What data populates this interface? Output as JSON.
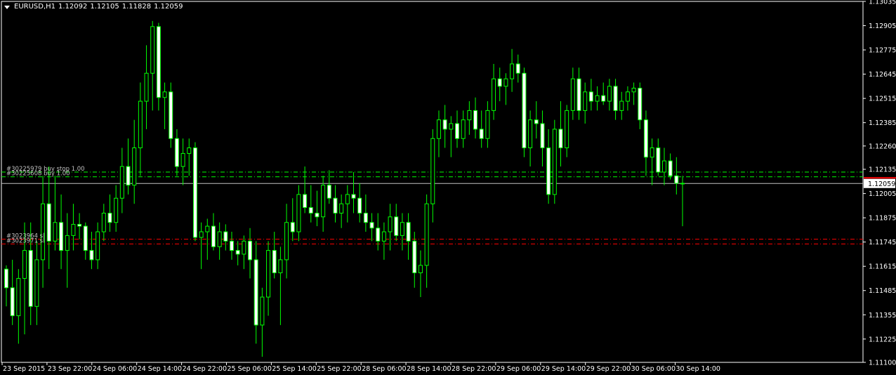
{
  "header": {
    "symbol": "EURUSD,H1",
    "open": "1.12092",
    "high": "1.12105",
    "low": "1.11828",
    "close": "1.12059"
  },
  "colors": {
    "background": "#000000",
    "axis": "#ffffff",
    "candle_up_fill": "#000000",
    "candle_down_fill": "#ffffff",
    "candle_wick": "#00ff00",
    "bid_line": "#c0c0c0",
    "price_marker_bg": "#ffffff",
    "price_marker_text": "#000000",
    "order_buy_line": "#00ff00",
    "order_sell_line": "#ff0000"
  },
  "chart_data": {
    "type": "candlestick",
    "grid": false,
    "y_range": [
      1.111,
      1.13035
    ],
    "y_ticks": [
      "1.13035",
      "1.12905",
      "1.12775",
      "1.12645",
      "1.12515",
      "1.12385",
      "1.12260",
      "1.12135",
      "1.12005",
      "1.11875",
      "1.11745",
      "1.11615",
      "1.11485",
      "1.11355",
      "1.11225",
      "1.11100"
    ],
    "x_ticks": [
      "23 Sep 2015",
      "23 Sep 22:00",
      "24 Sep 06:00",
      "24 Sep 14:00",
      "24 Sep 22:00",
      "25 Sep 06:00",
      "25 Sep 14:00",
      "25 Sep 22:00",
      "28 Sep 06:00",
      "28 Sep 14:00",
      "28 Sep 22:00",
      "29 Sep 06:00",
      "29 Sep 14:00",
      "29 Sep 22:00",
      "30 Sep 06:00",
      "30 Sep 14:00"
    ],
    "current_price": "1.12059",
    "order_lines": [
      {
        "label": "#30225979 buy stop 1.00",
        "price": 1.1212,
        "style": "dash-dot",
        "color": "#00ff00"
      },
      {
        "label": "#30225608 buy 1.00",
        "price": 1.12095,
        "style": "dash-dot",
        "color": "#00ff00"
      },
      {
        "label": "#3023964 sl",
        "price": 1.1176,
        "style": "dash-dot",
        "color": "#ff0000"
      },
      {
        "label": "#3023971 sl",
        "price": 1.11735,
        "style": "dash-dot",
        "color": "#ff0000"
      }
    ],
    "candles": [
      {
        "o": 1.116,
        "h": 1.1162,
        "l": 1.114,
        "c": 1.115
      },
      {
        "o": 1.115,
        "h": 1.1165,
        "l": 1.113,
        "c": 1.1135
      },
      {
        "o": 1.1135,
        "h": 1.116,
        "l": 1.112,
        "c": 1.1155
      },
      {
        "o": 1.1155,
        "h": 1.1185,
        "l": 1.1125,
        "c": 1.117
      },
      {
        "o": 1.117,
        "h": 1.1185,
        "l": 1.113,
        "c": 1.114
      },
      {
        "o": 1.114,
        "h": 1.1175,
        "l": 1.113,
        "c": 1.1165
      },
      {
        "o": 1.1165,
        "h": 1.121,
        "l": 1.115,
        "c": 1.1195
      },
      {
        "o": 1.1195,
        "h": 1.1215,
        "l": 1.116,
        "c": 1.1175
      },
      {
        "o": 1.1175,
        "h": 1.121,
        "l": 1.117,
        "c": 1.1185
      },
      {
        "o": 1.1185,
        "h": 1.12,
        "l": 1.116,
        "c": 1.117
      },
      {
        "o": 1.117,
        "h": 1.119,
        "l": 1.115,
        "c": 1.1178
      },
      {
        "o": 1.1178,
        "h": 1.1195,
        "l": 1.117,
        "c": 1.1184
      },
      {
        "o": 1.1184,
        "h": 1.119,
        "l": 1.1176,
        "c": 1.1183
      },
      {
        "o": 1.1183,
        "h": 1.1185,
        "l": 1.1165,
        "c": 1.117
      },
      {
        "o": 1.117,
        "h": 1.118,
        "l": 1.116,
        "c": 1.1165
      },
      {
        "o": 1.1165,
        "h": 1.1185,
        "l": 1.116,
        "c": 1.118
      },
      {
        "o": 1.118,
        "h": 1.1195,
        "l": 1.1175,
        "c": 1.119
      },
      {
        "o": 1.119,
        "h": 1.12,
        "l": 1.118,
        "c": 1.1185
      },
      {
        "o": 1.1185,
        "h": 1.1205,
        "l": 1.118,
        "c": 1.1198
      },
      {
        "o": 1.1198,
        "h": 1.1225,
        "l": 1.119,
        "c": 1.1215
      },
      {
        "o": 1.1215,
        "h": 1.123,
        "l": 1.12,
        "c": 1.1205
      },
      {
        "o": 1.1205,
        "h": 1.124,
        "l": 1.1195,
        "c": 1.1225
      },
      {
        "o": 1.1225,
        "h": 1.126,
        "l": 1.121,
        "c": 1.125
      },
      {
        "o": 1.125,
        "h": 1.128,
        "l": 1.1235,
        "c": 1.1265
      },
      {
        "o": 1.1265,
        "h": 1.1293,
        "l": 1.1245,
        "c": 1.129
      },
      {
        "o": 1.129,
        "h": 1.1292,
        "l": 1.1245,
        "c": 1.1252
      },
      {
        "o": 1.1252,
        "h": 1.126,
        "l": 1.1235,
        "c": 1.1255
      },
      {
        "o": 1.1255,
        "h": 1.126,
        "l": 1.1225,
        "c": 1.123
      },
      {
        "o": 1.123,
        "h": 1.1235,
        "l": 1.121,
        "c": 1.1215
      },
      {
        "o": 1.1215,
        "h": 1.123,
        "l": 1.1205,
        "c": 1.1222
      },
      {
        "o": 1.1222,
        "h": 1.123,
        "l": 1.121,
        "c": 1.1225
      },
      {
        "o": 1.1225,
        "h": 1.1228,
        "l": 1.1175,
        "c": 1.1177
      },
      {
        "o": 1.1177,
        "h": 1.1185,
        "l": 1.116,
        "c": 1.118
      },
      {
        "o": 1.118,
        "h": 1.1187,
        "l": 1.1165,
        "c": 1.1183
      },
      {
        "o": 1.1183,
        "h": 1.119,
        "l": 1.117,
        "c": 1.1172
      },
      {
        "o": 1.1172,
        "h": 1.1185,
        "l": 1.1165,
        "c": 1.118
      },
      {
        "o": 1.118,
        "h": 1.1184,
        "l": 1.117,
        "c": 1.1175
      },
      {
        "o": 1.1175,
        "h": 1.118,
        "l": 1.1165,
        "c": 1.117
      },
      {
        "o": 1.117,
        "h": 1.1175,
        "l": 1.1162,
        "c": 1.1168
      },
      {
        "o": 1.1168,
        "h": 1.1178,
        "l": 1.116,
        "c": 1.1175
      },
      {
        "o": 1.1175,
        "h": 1.1182,
        "l": 1.1155,
        "c": 1.1165
      },
      {
        "o": 1.1165,
        "h": 1.1175,
        "l": 1.112,
        "c": 1.113
      },
      {
        "o": 1.113,
        "h": 1.115,
        "l": 1.1113,
        "c": 1.1145
      },
      {
        "o": 1.1145,
        "h": 1.1175,
        "l": 1.1135,
        "c": 1.117
      },
      {
        "o": 1.117,
        "h": 1.118,
        "l": 1.1155,
        "c": 1.1158
      },
      {
        "o": 1.1158,
        "h": 1.1172,
        "l": 1.113,
        "c": 1.1165
      },
      {
        "o": 1.1165,
        "h": 1.1195,
        "l": 1.1155,
        "c": 1.1185
      },
      {
        "o": 1.1185,
        "h": 1.1198,
        "l": 1.1175,
        "c": 1.118
      },
      {
        "o": 1.118,
        "h": 1.1205,
        "l": 1.1175,
        "c": 1.12
      },
      {
        "o": 1.12,
        "h": 1.1215,
        "l": 1.119,
        "c": 1.1193
      },
      {
        "o": 1.1193,
        "h": 1.1205,
        "l": 1.1185,
        "c": 1.119
      },
      {
        "o": 1.119,
        "h": 1.1202,
        "l": 1.1183,
        "c": 1.1188
      },
      {
        "o": 1.1188,
        "h": 1.121,
        "l": 1.118,
        "c": 1.1205
      },
      {
        "o": 1.1205,
        "h": 1.1213,
        "l": 1.1195,
        "c": 1.1198
      },
      {
        "o": 1.1198,
        "h": 1.1205,
        "l": 1.1185,
        "c": 1.119
      },
      {
        "o": 1.119,
        "h": 1.12,
        "l": 1.1182,
        "c": 1.1195
      },
      {
        "o": 1.1195,
        "h": 1.1205,
        "l": 1.1185,
        "c": 1.12
      },
      {
        "o": 1.12,
        "h": 1.1212,
        "l": 1.119,
        "c": 1.1198
      },
      {
        "o": 1.1198,
        "h": 1.1206,
        "l": 1.1185,
        "c": 1.119
      },
      {
        "o": 1.119,
        "h": 1.12,
        "l": 1.118,
        "c": 1.1185
      },
      {
        "o": 1.1185,
        "h": 1.119,
        "l": 1.1175,
        "c": 1.1182
      },
      {
        "o": 1.1182,
        "h": 1.119,
        "l": 1.117,
        "c": 1.1175
      },
      {
        "o": 1.1175,
        "h": 1.1185,
        "l": 1.1165,
        "c": 1.118
      },
      {
        "o": 1.118,
        "h": 1.1195,
        "l": 1.117,
        "c": 1.1188
      },
      {
        "o": 1.1188,
        "h": 1.1195,
        "l": 1.1175,
        "c": 1.1178
      },
      {
        "o": 1.1178,
        "h": 1.119,
        "l": 1.117,
        "c": 1.1185
      },
      {
        "o": 1.1185,
        "h": 1.119,
        "l": 1.1165,
        "c": 1.1175
      },
      {
        "o": 1.1175,
        "h": 1.118,
        "l": 1.115,
        "c": 1.1158
      },
      {
        "o": 1.1158,
        "h": 1.117,
        "l": 1.1145,
        "c": 1.1162
      },
      {
        "o": 1.1162,
        "h": 1.12,
        "l": 1.115,
        "c": 1.1195
      },
      {
        "o": 1.1195,
        "h": 1.1235,
        "l": 1.1185,
        "c": 1.123
      },
      {
        "o": 1.123,
        "h": 1.1245,
        "l": 1.122,
        "c": 1.124
      },
      {
        "o": 1.124,
        "h": 1.1248,
        "l": 1.1225,
        "c": 1.1235
      },
      {
        "o": 1.1235,
        "h": 1.1242,
        "l": 1.122,
        "c": 1.1238
      },
      {
        "o": 1.1238,
        "h": 1.1245,
        "l": 1.1225,
        "c": 1.123
      },
      {
        "o": 1.123,
        "h": 1.1245,
        "l": 1.1225,
        "c": 1.124
      },
      {
        "o": 1.124,
        "h": 1.125,
        "l": 1.1232,
        "c": 1.1245
      },
      {
        "o": 1.1245,
        "h": 1.1252,
        "l": 1.123,
        "c": 1.1235
      },
      {
        "o": 1.1235,
        "h": 1.1245,
        "l": 1.1225,
        "c": 1.123
      },
      {
        "o": 1.123,
        "h": 1.125,
        "l": 1.1225,
        "c": 1.1245
      },
      {
        "o": 1.1245,
        "h": 1.127,
        "l": 1.124,
        "c": 1.1262
      },
      {
        "o": 1.1262,
        "h": 1.1268,
        "l": 1.125,
        "c": 1.1258
      },
      {
        "o": 1.1258,
        "h": 1.1265,
        "l": 1.1248,
        "c": 1.1262
      },
      {
        "o": 1.1262,
        "h": 1.1278,
        "l": 1.1255,
        "c": 1.127
      },
      {
        "o": 1.127,
        "h": 1.1275,
        "l": 1.126,
        "c": 1.1265
      },
      {
        "o": 1.1265,
        "h": 1.1268,
        "l": 1.122,
        "c": 1.1225
      },
      {
        "o": 1.1225,
        "h": 1.1245,
        "l": 1.1215,
        "c": 1.124
      },
      {
        "o": 1.124,
        "h": 1.125,
        "l": 1.123,
        "c": 1.1238
      },
      {
        "o": 1.1238,
        "h": 1.1245,
        "l": 1.1215,
        "c": 1.1225
      },
      {
        "o": 1.1225,
        "h": 1.1235,
        "l": 1.1195,
        "c": 1.12
      },
      {
        "o": 1.12,
        "h": 1.124,
        "l": 1.1195,
        "c": 1.1235
      },
      {
        "o": 1.1235,
        "h": 1.125,
        "l": 1.1215,
        "c": 1.1225
      },
      {
        "o": 1.1225,
        "h": 1.1248,
        "l": 1.122,
        "c": 1.1245
      },
      {
        "o": 1.1245,
        "h": 1.1268,
        "l": 1.124,
        "c": 1.1262
      },
      {
        "o": 1.1262,
        "h": 1.1268,
        "l": 1.124,
        "c": 1.1245
      },
      {
        "o": 1.1245,
        "h": 1.126,
        "l": 1.1238,
        "c": 1.1255
      },
      {
        "o": 1.1255,
        "h": 1.1262,
        "l": 1.1245,
        "c": 1.125
      },
      {
        "o": 1.125,
        "h": 1.1258,
        "l": 1.1245,
        "c": 1.1253
      },
      {
        "o": 1.1253,
        "h": 1.126,
        "l": 1.1248,
        "c": 1.125
      },
      {
        "o": 1.125,
        "h": 1.1262,
        "l": 1.1245,
        "c": 1.1258
      },
      {
        "o": 1.1258,
        "h": 1.1262,
        "l": 1.124,
        "c": 1.1245
      },
      {
        "o": 1.1245,
        "h": 1.1255,
        "l": 1.124,
        "c": 1.125
      },
      {
        "o": 1.125,
        "h": 1.1258,
        "l": 1.1245,
        "c": 1.1255
      },
      {
        "o": 1.1255,
        "h": 1.126,
        "l": 1.1248,
        "c": 1.1257
      },
      {
        "o": 1.1257,
        "h": 1.126,
        "l": 1.1235,
        "c": 1.124
      },
      {
        "o": 1.124,
        "h": 1.1245,
        "l": 1.121,
        "c": 1.122
      },
      {
        "o": 1.122,
        "h": 1.123,
        "l": 1.1205,
        "c": 1.1225
      },
      {
        "o": 1.1225,
        "h": 1.123,
        "l": 1.121,
        "c": 1.1212
      },
      {
        "o": 1.1212,
        "h": 1.1225,
        "l": 1.1205,
        "c": 1.1218
      },
      {
        "o": 1.1218,
        "h": 1.1222,
        "l": 1.1208,
        "c": 1.121
      },
      {
        "o": 1.121,
        "h": 1.122,
        "l": 1.12,
        "c": 1.1206
      },
      {
        "o": 1.1206,
        "h": 1.121,
        "l": 1.1183,
        "c": 1.1206
      }
    ]
  }
}
